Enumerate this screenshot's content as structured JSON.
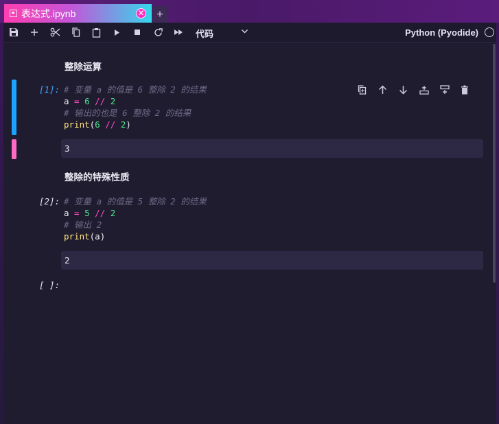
{
  "tab": {
    "title": "表达式.ipynb",
    "close_glyph": "✕",
    "new_tab_glyph": "+"
  },
  "toolbar": {
    "buttons": [
      "save-icon",
      "add-cell-icon",
      "cut-icon",
      "copy-icon",
      "paste-icon",
      "run-icon",
      "stop-icon",
      "restart-icon",
      "run-all-icon"
    ],
    "cell_type": "代码",
    "kernel_name": "Python (Pyodide)"
  },
  "cell_toolbar": [
    "duplicate-icon",
    "move-up-icon",
    "move-down-icon",
    "insert-below-icon",
    "insert-above-icon",
    "delete-icon"
  ],
  "cells": {
    "md1": "整除运算",
    "code1": {
      "prompt": "[1]:",
      "lines": {
        "c1": "# 变量 a 的值是 6 整除 2 的结果",
        "a_var": "a",
        "a_eq": " = ",
        "a_n1": "6",
        "a_op": " // ",
        "a_n2": "2",
        "c2": "# 输出的也是 6 整除 2 的结果",
        "p_fn": "print",
        "p_open": "(",
        "p_n1": "6",
        "p_op": " // ",
        "p_n2": "2",
        "p_close": ")"
      },
      "output": "3"
    },
    "md2": "整除的特殊性质",
    "code2": {
      "prompt": "[2]:",
      "lines": {
        "c1": "# 变量 a 的值是 5 整除 2 的结果",
        "a_var": "a",
        "a_eq": " = ",
        "a_n1": "5",
        "a_op": " // ",
        "a_n2": "2",
        "c2": "# 输出 2",
        "p_fn": "print",
        "p_rest": "(a)"
      },
      "output": "2"
    },
    "code3": {
      "prompt": "[ ]:"
    }
  },
  "colors": {
    "active_cell_bar": "#1aa3ff",
    "output_bar": "#ff6bc4",
    "prompt_active": "#3aa6ff",
    "prompt_idle": "#e8e6f0",
    "comment": "#6d6a87",
    "operator": "#ff4fc3",
    "number": "#4ee28c",
    "function": "#ffe77a"
  }
}
